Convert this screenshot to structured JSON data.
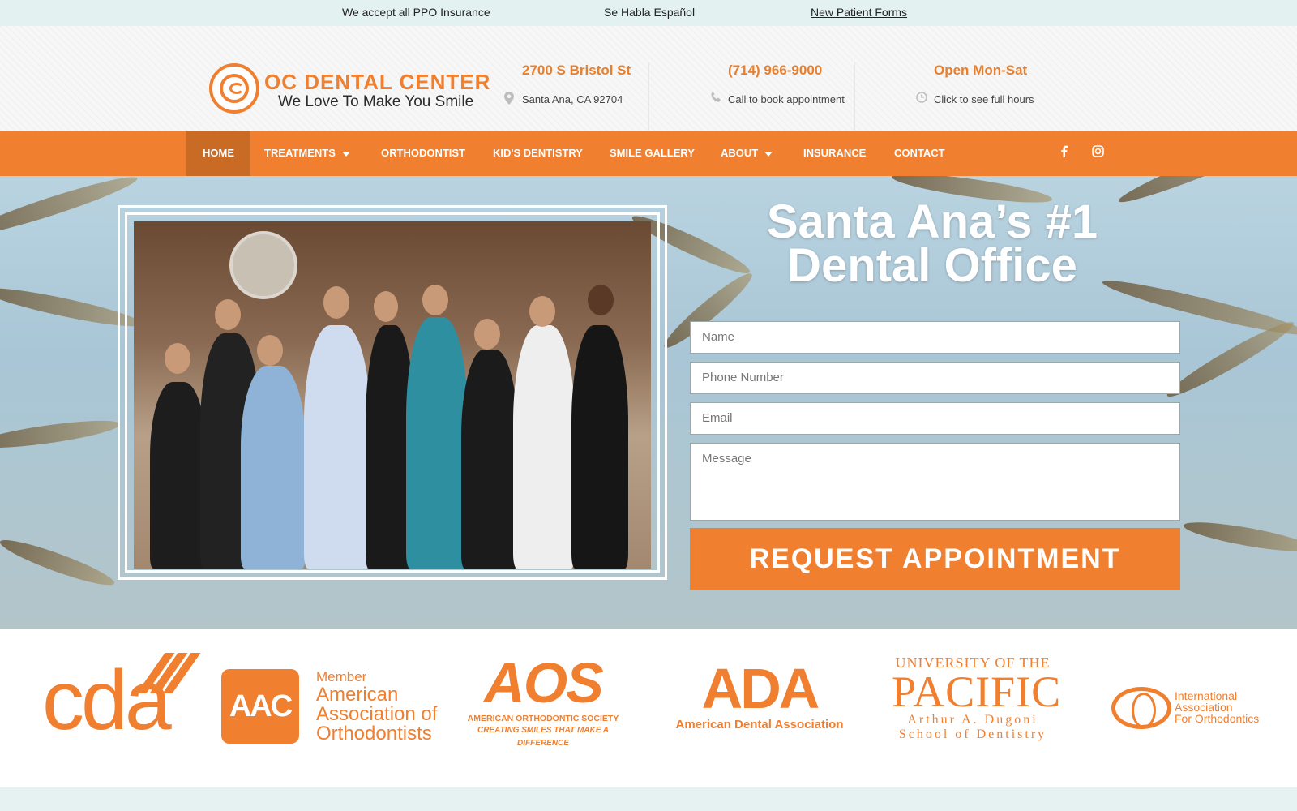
{
  "topbar": {
    "ppo": "We accept all PPO Insurance",
    "spanish": "Se Habla Español",
    "forms": "New Patient Forms"
  },
  "logo": {
    "title": "OC DENTAL CENTER",
    "tagline": "We Love To Make You Smile"
  },
  "header_blocks": [
    {
      "title": "2700 S Bristol St",
      "subtitle": "Santa Ana, CA 92704",
      "icon": "location-pin-icon"
    },
    {
      "title": "(714) 966-9000",
      "subtitle": "Call to book appointment",
      "icon": "phone-icon"
    },
    {
      "title": "Open Mon-Sat",
      "subtitle": "Click to see full hours",
      "icon": "clock-icon"
    }
  ],
  "nav": {
    "items": [
      "HOME",
      "TREATMENTS",
      "ORTHODONTIST",
      "KID'S DENTISTRY",
      "SMILE GALLERY",
      "ABOUT",
      "INSURANCE",
      "CONTACT"
    ],
    "social": [
      "facebook-icon",
      "instagram-icon"
    ]
  },
  "hero": {
    "title_line1": "Santa Ana’s #1",
    "title_line2": "Dental Office",
    "form": {
      "name_placeholder": "Name",
      "phone_placeholder": "Phone Number",
      "email_placeholder": "Email",
      "message_placeholder": "Message",
      "submit": "REQUEST APPOINTMENT"
    }
  },
  "affiliations": {
    "cda": "cda",
    "aac_box": "AAC",
    "aac_member": "Member",
    "aac_line1": "American",
    "aac_line2": "Association of",
    "aac_line3": "Orthodontists",
    "aos_big": "AOS",
    "aos_line1": "AMERICAN ORTHODONTIC SOCIETY",
    "aos_line2": "CREATING SMILES THAT MAKE A DIFFERENCE",
    "ada_big": "ADA",
    "ada_line": "American Dental Association",
    "uop_line1": "UNIVERSITY OF THE",
    "uop_line2": "PACIFIC",
    "uop_line3": "Arthur A. Dugoni",
    "uop_line4": "School of Dentistry",
    "iao_line1": "International",
    "iao_line2": "Association",
    "iao_line3": "For Orthodontics"
  },
  "colors": {
    "brand_orange": "#f07f2f",
    "nav_active": "#c96a25",
    "topbar_bg": "#e3f1f1"
  }
}
